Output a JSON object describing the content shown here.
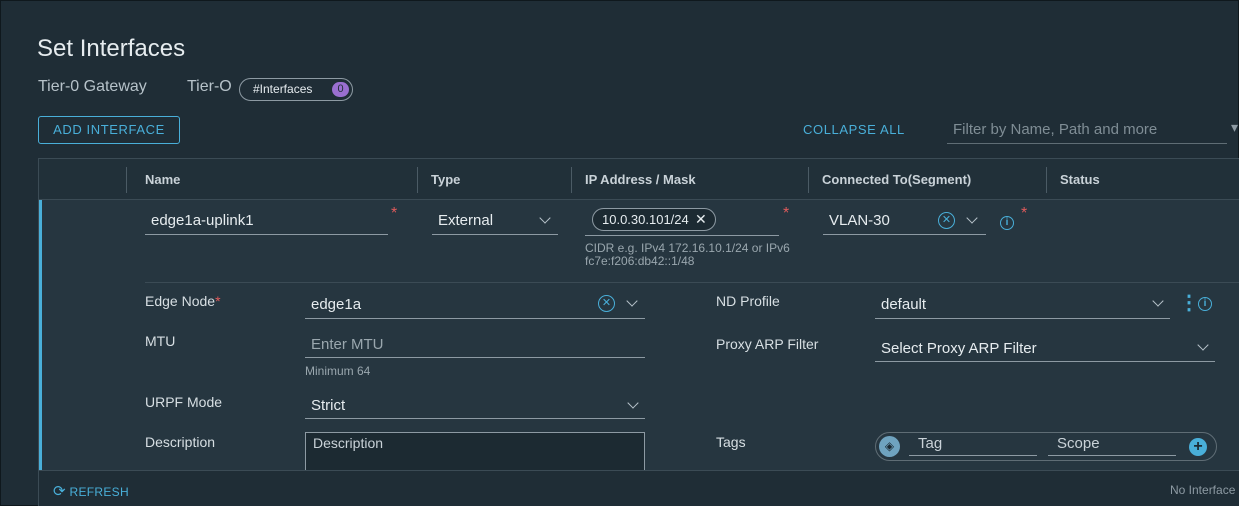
{
  "dialog": {
    "title": "Set Interfaces",
    "gateway_label": "Tier-0 Gateway",
    "gateway_value": "Tier-O",
    "interfaces_pill": "#Interfaces",
    "interfaces_count": "0"
  },
  "toolbar": {
    "add_interface": "ADD INTERFACE",
    "collapse_all": "COLLAPSE ALL",
    "filter_placeholder": "Filter by Name, Path and more"
  },
  "table": {
    "columns": [
      "Name",
      "Type",
      "IP Address / Mask",
      "Connected To(Segment)",
      "Status"
    ]
  },
  "row": {
    "name": "edge1a-uplink1",
    "type": "External",
    "ip_tag": "10.0.30.101/24",
    "ip_hint": "CIDR e.g. IPv4 172.16.10.1/24 or IPv6 fc7e:f206:db42::1/48",
    "segment": "VLAN-30",
    "edge_node_label": "Edge Node",
    "edge_node_value": "edge1a",
    "mtu_label": "MTU",
    "mtu_placeholder": "Enter MTU",
    "mtu_hint": "Minimum 64",
    "urpf_label": "URPF Mode",
    "urpf_value": "Strict",
    "description_label": "Description",
    "description_placeholder": "Description",
    "nd_profile_label": "ND Profile",
    "nd_profile_value": "default",
    "proxy_arp_label": "Proxy ARP Filter",
    "proxy_arp_value": "Select Proxy ARP Filter",
    "tags_label": "Tags",
    "tag_placeholder": "Tag",
    "scope_placeholder": "Scope"
  },
  "footer": {
    "refresh": "REFRESH",
    "status": "No Interface"
  },
  "colors": {
    "accent": "#49afd9",
    "required": "#e05b5b",
    "badge": "#9a6fd0"
  }
}
